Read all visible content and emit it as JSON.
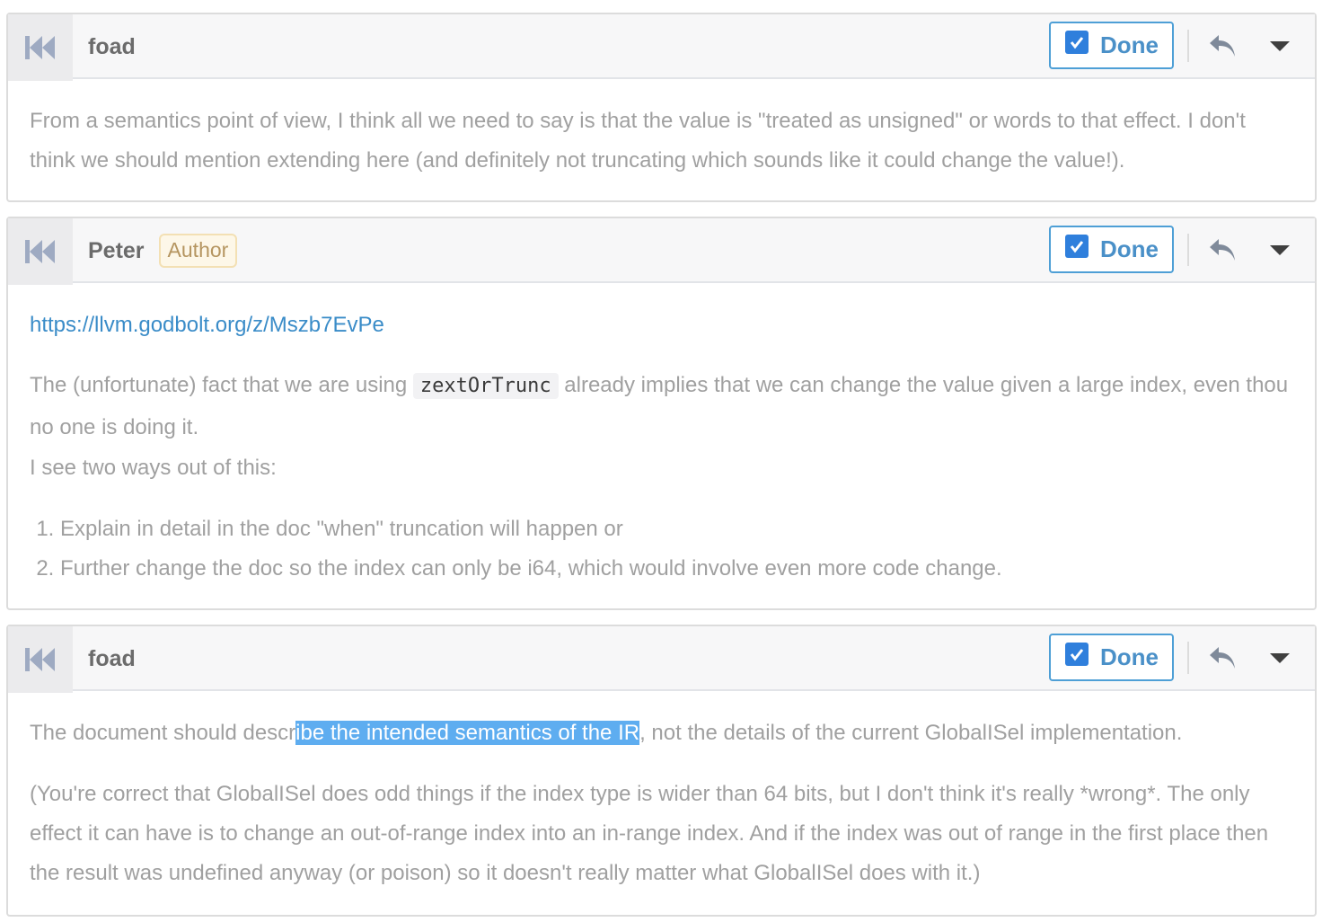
{
  "comments": [
    {
      "author": "foad",
      "done_label": "Done",
      "done_checked": true,
      "body": {
        "p1": "From a semantics point of view, I think all we need to say is that the value is \"treated as unsigned\" or words to that effect. I don't think we should mention extending here (and definitely not truncating which sounds like it could change the value!)."
      }
    },
    {
      "author": "Peter",
      "badge": "Author",
      "done_label": "Done",
      "done_checked": true,
      "body": {
        "link": "https://llvm.godbolt.org/z/Mszb7EvPe",
        "p1_before": "The (unfortunate) fact that we are using ",
        "code": "zextOrTrunc",
        "p1_after": " already implies that we can change the value given a large index, even thou no one is doing it.",
        "p2": "I see two ways out of this:",
        "list": [
          "Explain in detail in the doc \"when\" truncation will happen or",
          "Further change the doc so the index can only be i64, which would involve even more code change."
        ]
      }
    },
    {
      "author": "foad",
      "done_label": "Done",
      "done_checked": true,
      "body": {
        "p1_before": "The document should descr",
        "p1_highlight": "ibe the intended semantics of the IR",
        "p1_after": ", not the details of the current GlobalISel implementation.",
        "p2": "(You're correct that GlobalISel does odd things if the index type is wider than 64 bits, but I don't think it's really *wrong*. The only effect it can have is to change an out-of-range index into an in-range index. And if the index was out of range in the first place then the result was undefined anyway (or poison) so it doesn't really matter what GlobalISel does with it.)"
      }
    }
  ],
  "icons": {
    "jump": "jump-to-start-icon",
    "checkbox": "checkbox-checked-icon",
    "reply": "reply-icon",
    "menu": "chevron-down-icon"
  },
  "colors": {
    "done_border": "#4e9fd6",
    "done_text": "#4a90c8",
    "checkbox": "#2f7fdc",
    "link": "#3a8cc8",
    "selection": "#5eadf0",
    "badge_bg": "#fdf7e8"
  }
}
